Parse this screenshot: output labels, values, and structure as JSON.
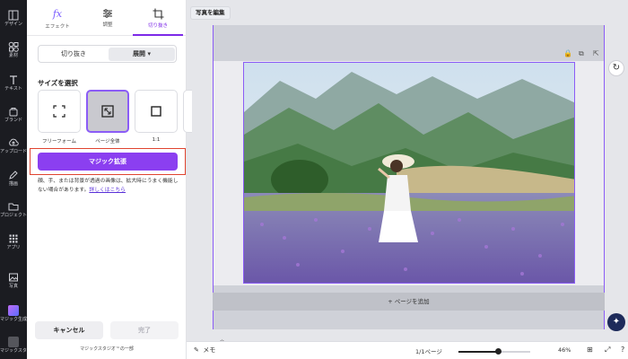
{
  "rail": [
    {
      "label": "デザイン",
      "icon": "layout-icon"
    },
    {
      "label": "素材",
      "icon": "elements-icon"
    },
    {
      "label": "テキスト",
      "icon": "text-icon"
    },
    {
      "label": "ブランド",
      "icon": "brand-icon"
    },
    {
      "label": "アップロード",
      "icon": "upload-icon"
    },
    {
      "label": "描画",
      "icon": "draw-icon"
    },
    {
      "label": "プロジェクト",
      "icon": "folder-icon"
    },
    {
      "label": "アプリ",
      "icon": "apps-icon"
    },
    {
      "label": "写真",
      "icon": "photo-icon"
    },
    {
      "label": "マジック生成",
      "icon": "magic-icon"
    },
    {
      "label": "マジックスタジオ",
      "icon": "studio-icon"
    }
  ],
  "tabs": [
    {
      "label": "エフェクト",
      "icon": "fx-icon"
    },
    {
      "label": "調整",
      "icon": "sliders-icon"
    },
    {
      "label": "切り抜き",
      "icon": "crop-icon",
      "active": true
    }
  ],
  "segment": {
    "left": "切り抜き",
    "right": "展開 ▾"
  },
  "section_title": "サイズを選択",
  "size_options": [
    {
      "label": "フリーフォーム",
      "glyph": "⛶"
    },
    {
      "label": "ページ全体",
      "glyph": "⤡"
    },
    {
      "label": "1:1",
      "glyph": "□"
    }
  ],
  "magic_button": "マジック拡張",
  "hint_text": "顔、手、または背景が透過の画像は、拡大時にうまく機能しない場合があります。",
  "hint_link": "詳しくはこちら",
  "cancel": "キャンセル",
  "done": "完了",
  "footnote": "マジックスタジオ™の一部",
  "edit_photo": "写真を編集",
  "add_page": "+ ページを追加",
  "bottom": {
    "memo": "メモ",
    "pages": "1/1ページ",
    "zoom": "46%",
    "zoom_value": 0.55
  },
  "colors": {
    "accent": "#8b3ff0",
    "highlight": "#e0442f"
  }
}
